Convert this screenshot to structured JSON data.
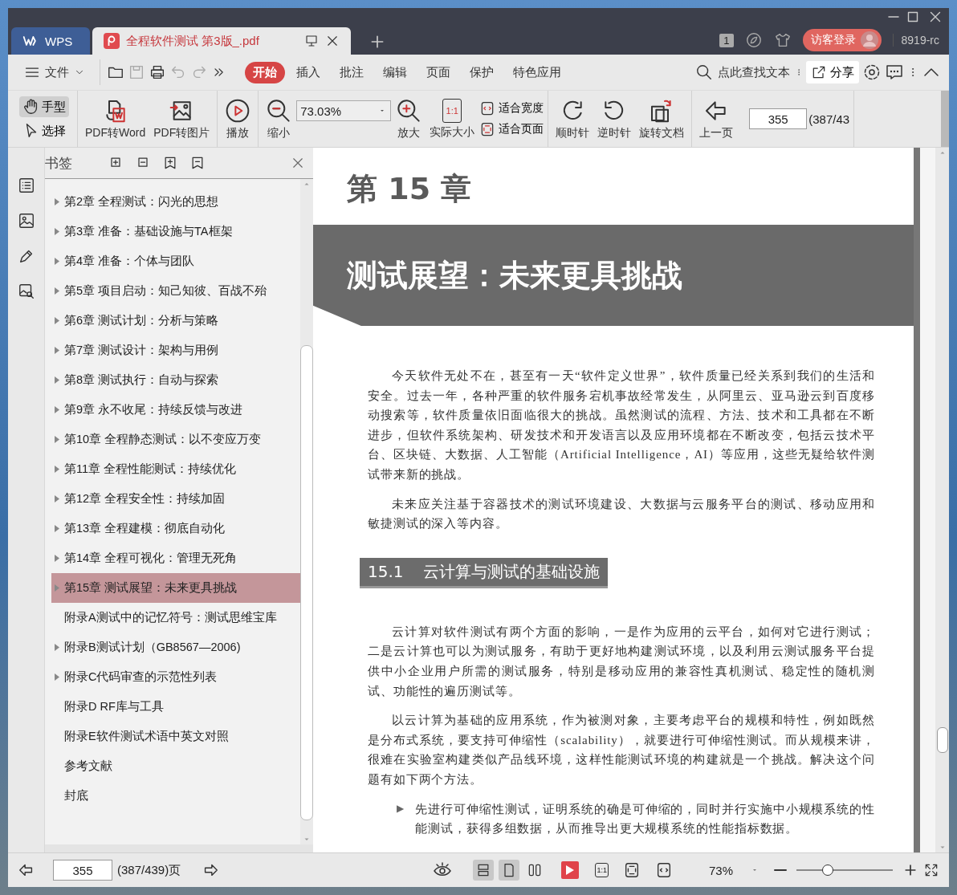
{
  "window": {
    "tabs": [
      {
        "kind": "home",
        "label": "WPS",
        "selected": false
      },
      {
        "kind": "pdf",
        "label": "全程软件测试 第3版_.pdf",
        "selected": true
      }
    ],
    "badge": "1",
    "login": "访客登录",
    "account": "8919-rc"
  },
  "menu": {
    "file": "文件",
    "tabs": [
      {
        "label": "开始",
        "selected": true
      },
      {
        "label": "插入",
        "selected": false
      },
      {
        "label": "批注",
        "selected": false
      },
      {
        "label": "编辑",
        "selected": false
      },
      {
        "label": "页面",
        "selected": false
      },
      {
        "label": "保护",
        "selected": false
      },
      {
        "label": "特色应用",
        "selected": false
      }
    ],
    "search": "点此查找文本",
    "share": "分享"
  },
  "toolbar": {
    "modes": [
      {
        "kind": "hand",
        "label": "手型",
        "selected": true
      },
      {
        "kind": "select",
        "label": "选择",
        "selected": false
      }
    ],
    "groups": [
      [
        {
          "kind": "pdf-word",
          "label": "PDF转Word"
        },
        {
          "kind": "pdf-image",
          "label": "PDF转图片"
        }
      ],
      [
        {
          "kind": "play",
          "label": "播放"
        }
      ],
      [
        {
          "kind": "zoom-out",
          "label": "缩小"
        },
        {
          "kind": "zoom-field",
          "value": "73.03%"
        },
        {
          "kind": "zoom-in",
          "label": "放大"
        },
        {
          "kind": "actual-size",
          "label": "实际大小",
          "glyph": "1:1"
        },
        {
          "kind": "fit",
          "options": [
            "适合宽度",
            "适合页面"
          ]
        }
      ],
      [
        {
          "kind": "clockwise",
          "label": "顺时针"
        },
        {
          "kind": "counterclockwise",
          "label": "逆时针"
        },
        {
          "kind": "rotate",
          "label": "旋转文档"
        }
      ],
      [
        {
          "kind": "prev",
          "label": "上一页"
        },
        {
          "kind": "page-field",
          "value": "355",
          "total": "(387/43"
        }
      ]
    ]
  },
  "bookmarks": {
    "title": "书签",
    "items": [
      {
        "label": "第2章  全程测试：闪光的思想",
        "expandable": true,
        "selected": false
      },
      {
        "label": "第3章  准备：基础设施与TA框架",
        "expandable": true,
        "selected": false
      },
      {
        "label": "第4章  准备：个体与团队",
        "expandable": true,
        "selected": false
      },
      {
        "label": "第5章  项目启动：知己知彼、百战不殆",
        "expandable": true,
        "selected": false
      },
      {
        "label": "第6章  测试计划：分析与策略",
        "expandable": true,
        "selected": false
      },
      {
        "label": "第7章  测试设计：架构与用例",
        "expandable": true,
        "selected": false
      },
      {
        "label": "第8章  测试执行：自动与探索",
        "expandable": true,
        "selected": false
      },
      {
        "label": "第9章  永不收尾：持续反馈与改进",
        "expandable": true,
        "selected": false
      },
      {
        "label": "第10章  全程静态测试：以不变应万变",
        "expandable": true,
        "selected": false
      },
      {
        "label": "第11章  全程性能测试：持续优化",
        "expandable": true,
        "selected": false
      },
      {
        "label": "第12章  全程安全性：持续加固",
        "expandable": true,
        "selected": false
      },
      {
        "label": "第13章  全程建模：彻底自动化",
        "expandable": true,
        "selected": false
      },
      {
        "label": "第14章  全程可视化：管理无死角",
        "expandable": true,
        "selected": false
      },
      {
        "label": "第15章  测试展望：未来更具挑战",
        "expandable": true,
        "selected": true
      },
      {
        "label": "附录A测试中的记忆符号：测试思维宝库",
        "expandable": false,
        "selected": false
      },
      {
        "label": "附录B测试计划（GB8567—2006)",
        "expandable": true,
        "selected": false
      },
      {
        "label": "附录C代码审查的示范性列表",
        "expandable": true,
        "selected": false
      },
      {
        "label": "附录D RF库与工具",
        "expandable": false,
        "selected": false
      },
      {
        "label": "附录E软件测试术语中英文对照",
        "expandable": false,
        "selected": false
      },
      {
        "label": "参考文献",
        "expandable": false,
        "selected": false
      },
      {
        "label": "封底",
        "expandable": false,
        "selected": false
      }
    ]
  },
  "document": {
    "chapter_number": "第 15 章",
    "chapter_title": "测试展望：未来更具挑战",
    "blocks": [
      {
        "kind": "paragraph",
        "text": "今天软件无处不在，甚至有一天“软件定义世界”，软件质量已经关系到我们的生活和安全。过去一年，各种严重的软件服务宕机事故经常发生，从阿里云、亚马逊云到百度移动搜索等，软件质量依旧面临很大的挑战。虽然测试的流程、方法、技术和工具都在不断进步，但软件系统架构、研发技术和开发语言以及应用环境都在不断改变，包括云技术平台、区块链、大数据、人工智能（Artificial Intelligence，AI）等应用，这些无疑给软件测试带来新的挑战。"
      },
      {
        "kind": "paragraph",
        "text": "未来应关注基于容器技术的测试环境建设、大数据与云服务平台的测试、移动应用和敏捷测试的深入等内容。"
      },
      {
        "kind": "heading",
        "number": "15.1",
        "text": "云计算与测试的基础设施"
      },
      {
        "kind": "paragraph",
        "text": "云计算对软件测试有两个方面的影响，一是作为应用的云平台，如何对它进行测试；二是云计算也可以为测试服务，有助于更好地构建测试环境，以及利用云测试服务平台提供中小企业用户所需的测试服务，特别是移动应用的兼容性真机测试、稳定性的随机测试、功能性的遍历测试等。"
      },
      {
        "kind": "paragraph",
        "text": "以云计算为基础的应用系统，作为被测对象，主要考虑平台的规模和特性，例如既然是分布式系统，要支持可伸缩性（scalability），就要进行可伸缩性测试。而从规模来讲，很难在实验室构建类似产品线环境，这样性能测试环境的构建就是一个挑战。解决这个问题有如下两个方法。"
      },
      {
        "kind": "bullet",
        "marker": "▶",
        "text": "先进行可伸缩性测试，证明系统的确是可伸缩的，同时并行实施中小规模系统的性能测试，获得多组数据，从而推导出更大规模系统的性能指标数据。"
      }
    ]
  },
  "status_bar": {
    "page": "355",
    "total": "(387/439)页",
    "views": [
      {
        "kind": "continuous",
        "selected": true
      },
      {
        "kind": "single",
        "selected": true
      },
      {
        "kind": "double",
        "selected": false
      }
    ],
    "actual_glyph": "1:1",
    "zoom": "73%",
    "zoom_slider": {
      "level": 0.3
    }
  }
}
